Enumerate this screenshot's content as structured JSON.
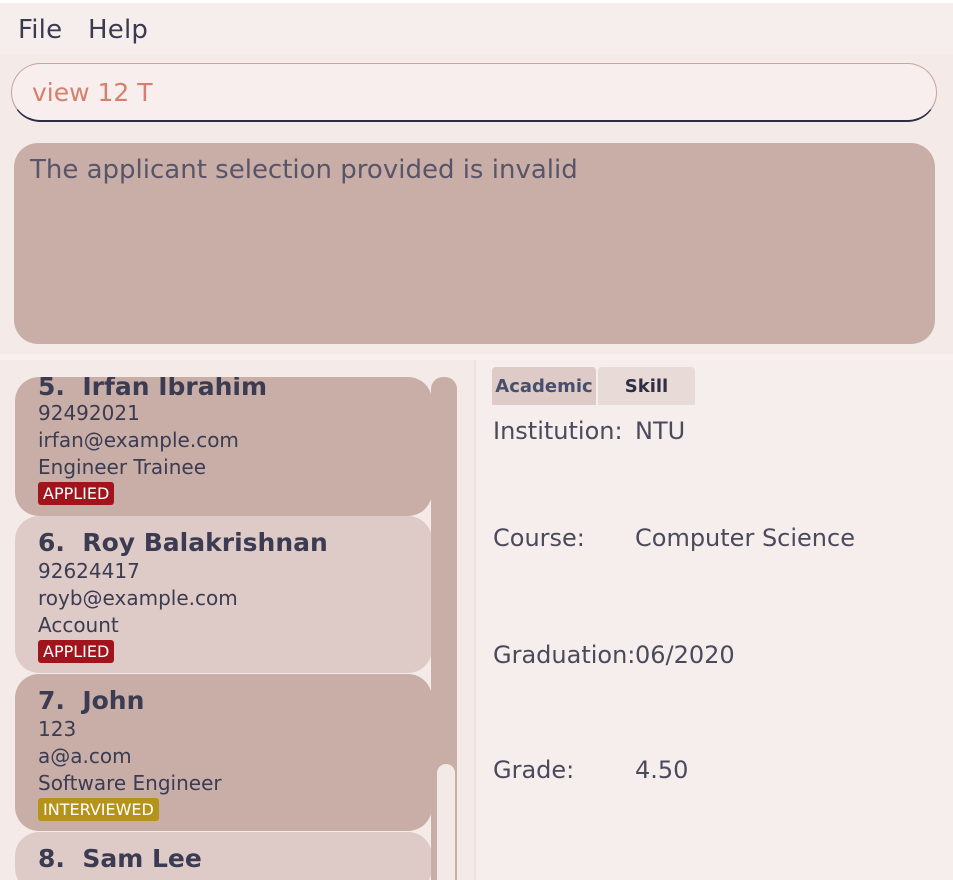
{
  "menu": {
    "file": "File",
    "help": "Help"
  },
  "command": {
    "value": "view 12 T"
  },
  "result": {
    "message": "The applicant selection provided is invalid"
  },
  "applicants": [
    {
      "index": "5.",
      "name": "Irfan Ibrahim",
      "phone": "92492021",
      "email": "irfan@example.com",
      "role": "Engineer Trainee",
      "status": "APPLIED"
    },
    {
      "index": "6.",
      "name": "Roy Balakrishnan",
      "phone": "92624417",
      "email": "royb@example.com",
      "role": "Account",
      "status": "APPLIED"
    },
    {
      "index": "7.",
      "name": "John",
      "phone": "123",
      "email": "a@a.com",
      "role": "Software Engineer",
      "status": "INTERVIEWED"
    },
    {
      "index": "8.",
      "name": "Sam Lee"
    }
  ],
  "tabs": {
    "academic": "Academic",
    "skill": "Skill"
  },
  "details": {
    "institution_label": "Institution:",
    "institution": "NTU",
    "course_label": "Course:",
    "course": "Computer Science",
    "graduation_label": "Graduation:",
    "graduation": "06/2020",
    "grade_label": "Grade:",
    "grade": "4.50"
  },
  "colors": {
    "applied": "#a2141c",
    "interviewed": "#b5921a",
    "card_dark": "#c8aea7",
    "card_light": "#decbc7"
  }
}
